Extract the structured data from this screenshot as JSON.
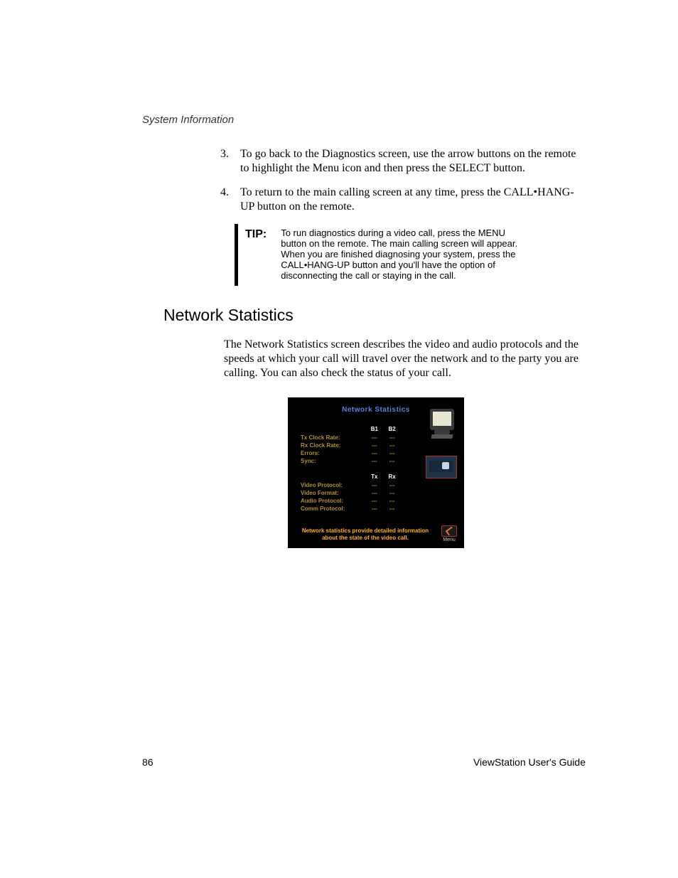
{
  "header": {
    "breadcrumb": "System Information"
  },
  "list": {
    "items": [
      {
        "num": "3.",
        "text": "To go back to the Diagnostics screen, use the arrow buttons on the remote to highlight the Menu icon and then press the SELECT button."
      },
      {
        "num": "4.",
        "text": "To return to the main calling screen at any time, press the CALL•HANG-UP button on the remote."
      }
    ]
  },
  "tip": {
    "label": "TIP:",
    "text": "To run diagnostics during a video call, press the MENU button on the remote. The main calling screen will appear. When you are finished diagnosing your system, press the CALL•HANG-UP button and you'll have the option of disconnecting the call or staying in the call."
  },
  "section": {
    "heading": "Network Statistics",
    "paragraph": "The Network Statistics screen describes the video and audio protocols and the speeds at which your call will travel over the network and to the party you are calling. You can also check the status of your call."
  },
  "screenshot": {
    "title": "Network  Statistics",
    "headersA": [
      "B1",
      "B2"
    ],
    "rowsA": [
      {
        "label": "Tx Clock Rate:",
        "c1": "---",
        "c2": "---"
      },
      {
        "label": "Rx Clock Rate:",
        "c1": "---",
        "c2": "---"
      },
      {
        "label": "Errors:",
        "c1": "---",
        "c2": "---"
      },
      {
        "label": "Sync:",
        "c1": "---",
        "c2": "---"
      }
    ],
    "headersB": [
      "Tx",
      "Rx"
    ],
    "rowsB": [
      {
        "label": "Video Protocol:",
        "c1": "---",
        "c2": "---"
      },
      {
        "label": "Video Format:",
        "c1": "---",
        "c2": "---"
      },
      {
        "label": "Audio Protocol:",
        "c1": "---",
        "c2": "---"
      },
      {
        "label": "Comm Protocol:",
        "c1": "---",
        "c2": "---"
      }
    ],
    "caption_line1": "Network statistics provide detailed information",
    "caption_line2": "about the state of the video call.",
    "menu_label": "Menu"
  },
  "footer": {
    "page": "86",
    "title": "ViewStation User's Guide"
  }
}
